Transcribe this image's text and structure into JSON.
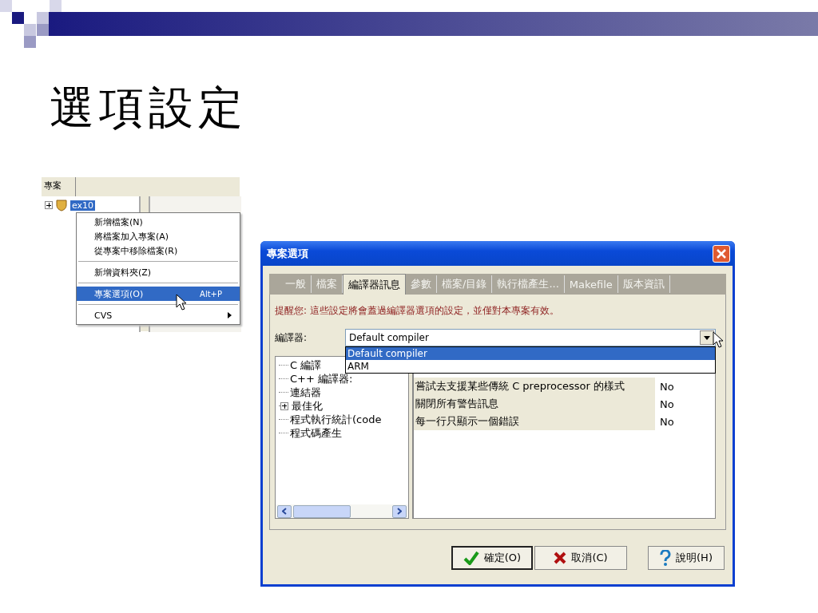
{
  "slide": {
    "title": "選項設定"
  },
  "project_panel": {
    "tab": "專案",
    "tree": [
      {
        "label": "ex10",
        "selected": true,
        "expanded": false
      }
    ]
  },
  "context_menu": {
    "items": [
      {
        "kind": "item",
        "label": "新增檔案(N)",
        "selected": false
      },
      {
        "kind": "item",
        "label": "將檔案加入專案(A)",
        "selected": false
      },
      {
        "kind": "item",
        "label": "從專案中移除檔案(R)",
        "selected": false
      },
      {
        "kind": "separator"
      },
      {
        "kind": "item",
        "label": "新增資料夾(Z)",
        "selected": false
      },
      {
        "kind": "separator"
      },
      {
        "kind": "item",
        "label": "專案選項(O)",
        "shortcut": "Alt+P",
        "selected": true
      },
      {
        "kind": "separator"
      },
      {
        "kind": "submenu",
        "label": "CVS",
        "selected": false
      }
    ]
  },
  "dialog": {
    "title": "專案選項",
    "tabs": [
      {
        "label": "一般",
        "selected": false
      },
      {
        "label": "檔案",
        "selected": false
      },
      {
        "label": "編譯器訊息",
        "selected": true
      },
      {
        "label": "參數",
        "selected": false
      },
      {
        "label": "檔案/目錄",
        "selected": false
      },
      {
        "label": "執行檔產生...",
        "selected": false
      },
      {
        "label": "Makefile",
        "selected": false
      },
      {
        "label": "版本資訊",
        "selected": false
      }
    ],
    "notice": "提醒您: 這些設定將會蓋過編譯器選項的設定，並僅對本專案有效。",
    "compiler": {
      "label": "編譯器:",
      "value": "Default compiler",
      "expanded": true,
      "options": [
        {
          "label": "Default compiler",
          "selected": true
        },
        {
          "label": "ARM",
          "selected": false
        }
      ]
    },
    "tree": [
      {
        "kind": "leaf",
        "label": "C 編譯"
      },
      {
        "kind": "leaf",
        "label": "C++ 編譯器:"
      },
      {
        "kind": "leaf",
        "label": "連結器"
      },
      {
        "kind": "branch",
        "label": "最佳化",
        "expanded": false
      },
      {
        "kind": "leaf",
        "label": "程式執行統計(code"
      },
      {
        "kind": "leaf",
        "label": "程式碼產生"
      }
    ],
    "settings": [
      {
        "option": "嘗試去支援某些傳統 C preprocessor 的樣式",
        "value": "No"
      },
      {
        "option": "關閉所有警告訊息",
        "value": "No"
      },
      {
        "option": "每一行只顯示一個錯誤",
        "value": "No"
      }
    ],
    "buttons": [
      {
        "kind": "ok",
        "label": "確定(O)",
        "default": true
      },
      {
        "kind": "cancel",
        "label": "取消(C)",
        "default": false
      },
      {
        "kind": "help",
        "label": "說明(H)",
        "default": false
      }
    ]
  }
}
